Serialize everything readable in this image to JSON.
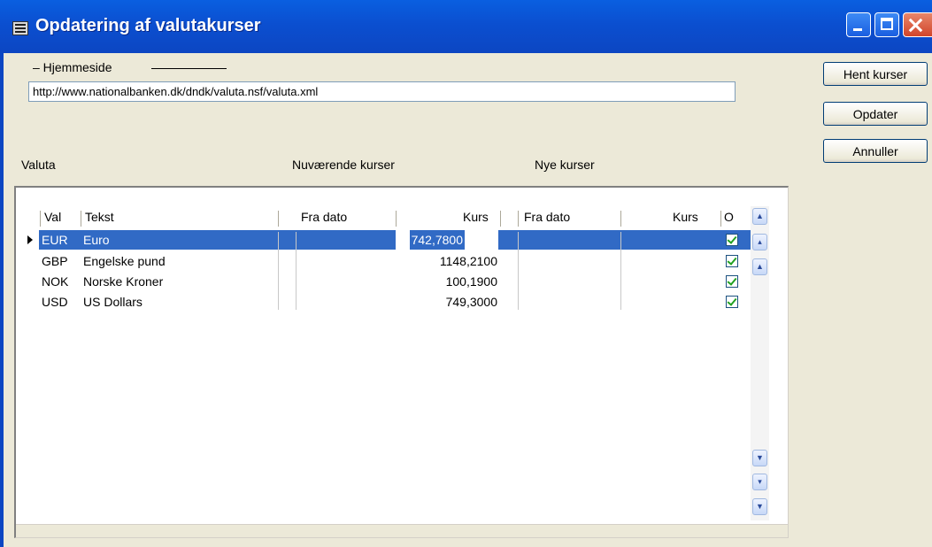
{
  "window": {
    "title": "Opdatering af valutakurser"
  },
  "homepage": {
    "group_label": "– Hjemmeside",
    "url": "http://www.nationalbanken.dk/dndk/valuta.nsf/valuta.xml"
  },
  "buttons": {
    "hent": "Hent kurser",
    "opdater": "Opdater",
    "annuller": "Annuller"
  },
  "section_labels": {
    "valuta": "Valuta",
    "current": "Nuværende kurser",
    "new": "Nye kurser"
  },
  "grid": {
    "headers": {
      "val": "Val",
      "tekst": "Tekst",
      "fra_dato_1": "Fra dato",
      "kurs_1": "Kurs",
      "fra_dato_2": "Fra dato",
      "kurs_2": "Kurs",
      "o": "O"
    },
    "rows": [
      {
        "val": "EUR",
        "tekst": "Euro",
        "kurs": "742,7800",
        "checked": true
      },
      {
        "val": "GBP",
        "tekst": "Engelske pund",
        "kurs": "1148,2100",
        "checked": true
      },
      {
        "val": "NOK",
        "tekst": "Norske Kroner",
        "kurs": "100,1900",
        "checked": true
      },
      {
        "val": "USD",
        "tekst": "US Dollars",
        "kurs": "749,3000",
        "checked": true
      }
    ],
    "selected_row": 0
  },
  "icons": {
    "app": "form-icon",
    "minimize": "minimize-icon",
    "maximize": "maximize-icon",
    "close": "close-icon",
    "nav_up": "arrow-up-icon",
    "nav_prev": "arrow-prev-icon",
    "nav_first": "arrow-first-icon",
    "nav_last": "arrow-last-icon",
    "nav_next": "arrow-next-icon",
    "nav_down": "arrow-down-icon"
  },
  "colors": {
    "titlebar": "#0b4fd0",
    "selection": "#316ac5",
    "window_bg": "#ece9d8"
  }
}
